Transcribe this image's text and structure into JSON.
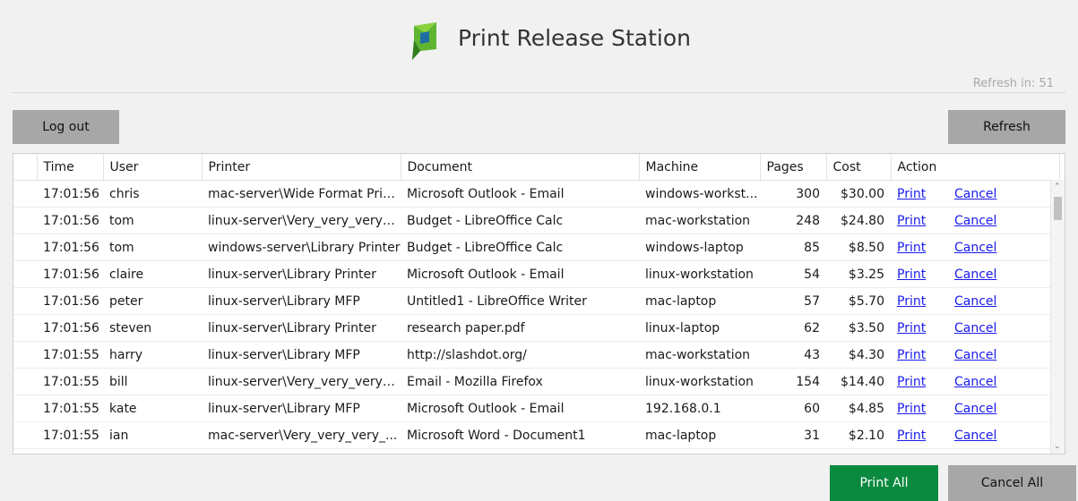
{
  "header": {
    "title": "Print Release Station",
    "refresh_text": "Refresh in: 51"
  },
  "buttons": {
    "logout": "Log out",
    "refresh": "Refresh",
    "print_all": "Print All",
    "cancel_all": "Cancel All"
  },
  "table": {
    "columns": [
      "Time",
      "User",
      "Printer",
      "Document",
      "Machine",
      "Pages",
      "Cost",
      "Action"
    ],
    "rows": [
      {
        "time": "17:01:56",
        "user": "chris",
        "printer": "mac-server\\Wide Format Prin...",
        "document": "Microsoft Outlook - Email",
        "machine": "windows-workst...",
        "pages": "300",
        "cost": "$30.00",
        "print": "Print",
        "cancel": "Cancel"
      },
      {
        "time": "17:01:56",
        "user": "tom",
        "printer": "linux-server\\Very_very_very_...",
        "document": "Budget - LibreOffice Calc",
        "machine": "mac-workstation",
        "pages": "248",
        "cost": "$24.80",
        "print": "Print",
        "cancel": "Cancel"
      },
      {
        "time": "17:01:56",
        "user": "tom",
        "printer": "windows-server\\Library Printer",
        "document": "Budget - LibreOffice Calc",
        "machine": "windows-laptop",
        "pages": "85",
        "cost": "$8.50",
        "print": "Print",
        "cancel": "Cancel"
      },
      {
        "time": "17:01:56",
        "user": "claire",
        "printer": "linux-server\\Library Printer",
        "document": "Microsoft Outlook - Email",
        "machine": "linux-workstation",
        "pages": "54",
        "cost": "$3.25",
        "print": "Print",
        "cancel": "Cancel"
      },
      {
        "time": "17:01:56",
        "user": "peter",
        "printer": "linux-server\\Library MFP",
        "document": "Untitled1 - LibreOffice Writer",
        "machine": "mac-laptop",
        "pages": "57",
        "cost": "$5.70",
        "print": "Print",
        "cancel": "Cancel"
      },
      {
        "time": "17:01:56",
        "user": "steven",
        "printer": "linux-server\\Library Printer",
        "document": "research paper.pdf",
        "machine": "linux-laptop",
        "pages": "62",
        "cost": "$3.50",
        "print": "Print",
        "cancel": "Cancel"
      },
      {
        "time": "17:01:55",
        "user": "harry",
        "printer": "linux-server\\Library MFP",
        "document": "http://slashdot.org/",
        "machine": "mac-workstation",
        "pages": "43",
        "cost": "$4.30",
        "print": "Print",
        "cancel": "Cancel"
      },
      {
        "time": "17:01:55",
        "user": "bill",
        "printer": "linux-server\\Very_very_very_...",
        "document": "Email - Mozilla Firefox",
        "machine": "linux-workstation",
        "pages": "154",
        "cost": "$14.40",
        "print": "Print",
        "cancel": "Cancel"
      },
      {
        "time": "17:01:55",
        "user": "kate",
        "printer": "linux-server\\Library MFP",
        "document": "Microsoft Outlook - Email",
        "machine": "192.168.0.1",
        "pages": "60",
        "cost": "$4.85",
        "print": "Print",
        "cancel": "Cancel"
      },
      {
        "time": "17:01:55",
        "user": "ian",
        "printer": "mac-server\\Very_very_very_...",
        "document": "Microsoft Word - Document1",
        "machine": "mac-laptop",
        "pages": "31",
        "cost": "$2.10",
        "print": "Print",
        "cancel": "Cancel"
      }
    ]
  },
  "icons": {
    "logo": "papercut-logo-icon",
    "scroll_up": "scroll-up-arrow-icon",
    "scroll_down": "scroll-down-arrow-icon"
  },
  "colors": {
    "accent": "#0a8a3e",
    "link": "#1a1aee",
    "button_gray": "#a7a7a7"
  }
}
